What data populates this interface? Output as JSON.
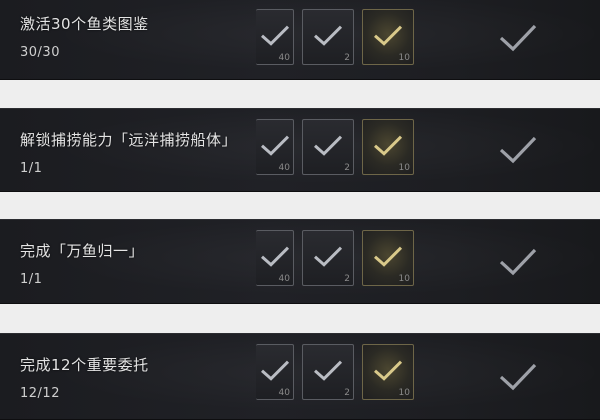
{
  "achievements": [
    {
      "title": "激活30个鱼类图鉴",
      "progress": "30/30",
      "slot_counts": [
        "40",
        "2",
        "10"
      ]
    },
    {
      "title": "解锁捕捞能力「远洋捕捞船体」",
      "progress": "1/1",
      "slot_counts": [
        "40",
        "2",
        "10"
      ]
    },
    {
      "title": "完成「万鱼归一」",
      "progress": "1/1",
      "slot_counts": [
        "40",
        "2",
        "10"
      ]
    },
    {
      "title": "完成12个重要委托",
      "progress": "12/12",
      "slot_counts": [
        "40",
        "2",
        "10"
      ]
    }
  ],
  "colors": {
    "row_bg": "#1f2024",
    "check_silver": "#b9bcc3",
    "check_gold": "#d9c98a",
    "gap_bg": "#eeeeee"
  },
  "icons": {
    "reward_claimed": "check-icon",
    "completed": "check-icon"
  }
}
